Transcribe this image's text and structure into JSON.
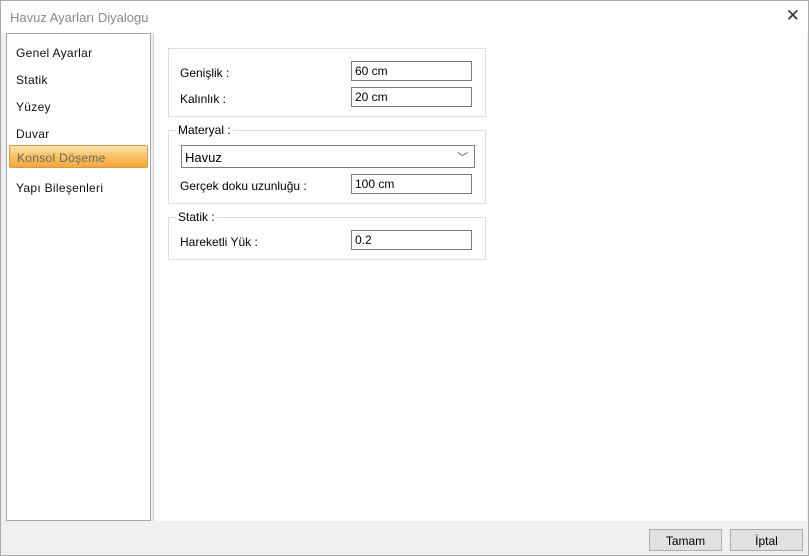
{
  "window": {
    "title": "Havuz Ayarları Diyalogu",
    "close_icon": "close-icon"
  },
  "sidebar": {
    "items": [
      {
        "label": "Genel Ayarlar"
      },
      {
        "label": "Statik"
      },
      {
        "label": "Yüzey"
      },
      {
        "label": "Duvar"
      },
      {
        "label": "Konsol Döşeme",
        "selected": true
      },
      {
        "label": "Yapı Bileşenleri"
      }
    ]
  },
  "dimensions": {
    "width_label": "Genişlik :",
    "width_value": "60 cm",
    "thickness_label": "Kalınlık :",
    "thickness_value": "20 cm"
  },
  "material": {
    "group_label": "Materyal :",
    "selected": "Havuz",
    "texture_label": "Gerçek doku uzunluğu :",
    "texture_value": "100 cm"
  },
  "static": {
    "group_label": "Statik :",
    "live_load_label": "Hareketli Yük :",
    "live_load_value": "0.2"
  },
  "buttons": {
    "ok": "Tamam",
    "cancel": "İptal"
  },
  "colors": {
    "selection": "#f9c063"
  }
}
